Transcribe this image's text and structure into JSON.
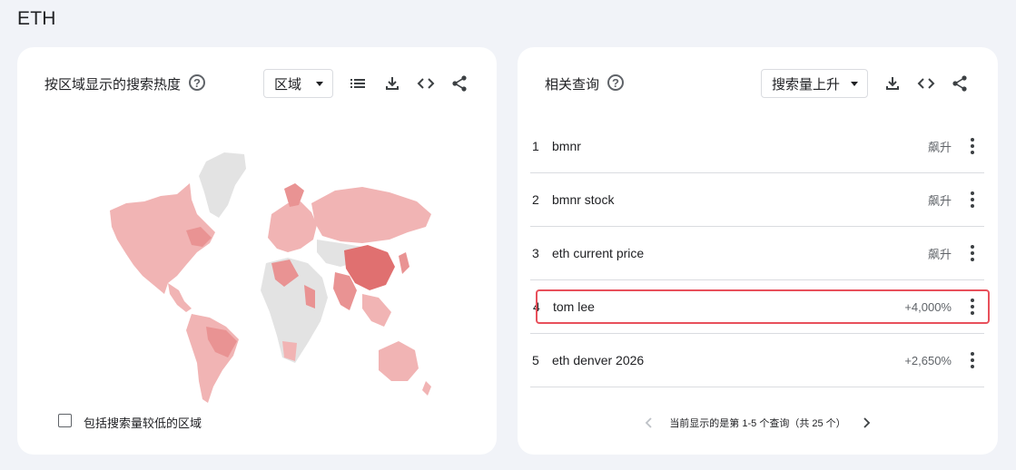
{
  "page": {
    "title": "ETH"
  },
  "region_card": {
    "title": "按区域显示的搜索热度",
    "select_value": "区域",
    "checkbox_label": "包括搜索量较低的区域"
  },
  "queries_card": {
    "title": "相关查询",
    "select_value": "搜索量上升",
    "rows": [
      {
        "rank": "1",
        "term": "bmnr",
        "value": "飙升"
      },
      {
        "rank": "2",
        "term": "bmnr stock",
        "value": "飙升"
      },
      {
        "rank": "3",
        "term": "eth current price",
        "value": "飙升"
      },
      {
        "rank": "4",
        "term": "tom lee",
        "value": "+4,000%"
      },
      {
        "rank": "5",
        "term": "eth denver 2026",
        "value": "+2,650%"
      }
    ],
    "pagination_text": "当前显示的是第 1-5 个查询（共 25 个）"
  },
  "icons": {
    "help": "question-circle-icon",
    "list": "list-icon",
    "download": "download-icon",
    "embed": "code-brackets-icon",
    "share": "share-icon"
  },
  "colors": {
    "map_light": "#f1b4b4",
    "map_medium": "#e99393",
    "map_dark": "#e07070",
    "map_nodata": "#e3e3e3",
    "highlight_border": "#e8505b"
  }
}
